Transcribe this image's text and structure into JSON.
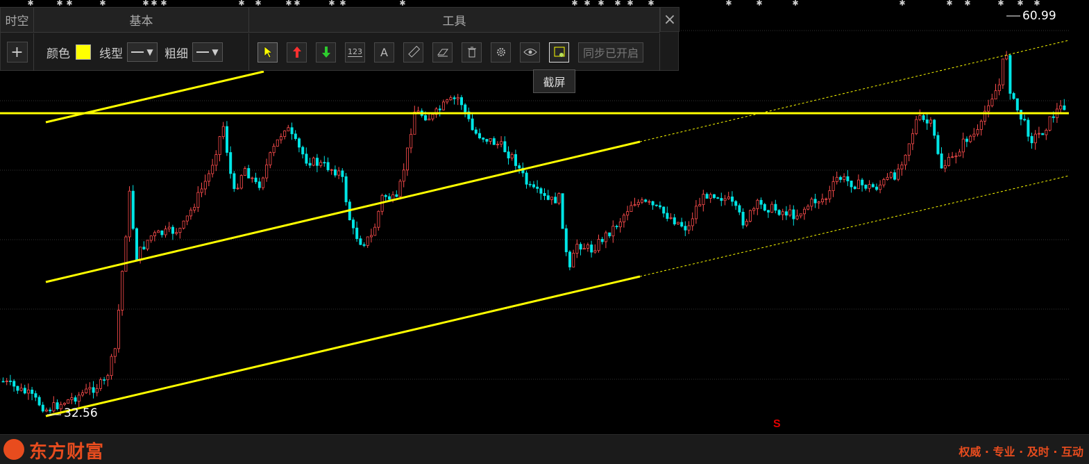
{
  "toolbar": {
    "tab_left": "时空",
    "tab_basic": "基本",
    "tab_tools": "工具",
    "color_label": "颜色",
    "color_value": "#ffff00",
    "linetype_label": "线型",
    "thickness_label": "粗细",
    "add_label": "+",
    "close_label": "×",
    "sync_label": "同步已开启",
    "tooltip": "截屏",
    "tools": [
      "cursor-icon",
      "arrow-up-icon",
      "arrow-down-icon",
      "number-label-icon",
      "text-icon",
      "ruler-icon",
      "eraser-icon",
      "trash-icon",
      "gear-icon",
      "eye-icon",
      "screenshot-icon"
    ]
  },
  "chart": {
    "high_label": "60.99",
    "low_label": "32.56",
    "marker_label": "S",
    "colors": {
      "up": "#ff4d4d",
      "down": "#00e5e5",
      "drawing": "#ffff00",
      "grid": "#333333"
    }
  },
  "chart_data": {
    "type": "candlestick",
    "title": "",
    "high": 60.99,
    "low": 32.56,
    "drawings": [
      "horizontal-line",
      "parallel-channel",
      "parallel-channel-extension-dashed"
    ],
    "grid": true
  },
  "footer": {
    "brand": "东方财富",
    "slogan": "权威 · 专业 · 及时 · 互动"
  }
}
